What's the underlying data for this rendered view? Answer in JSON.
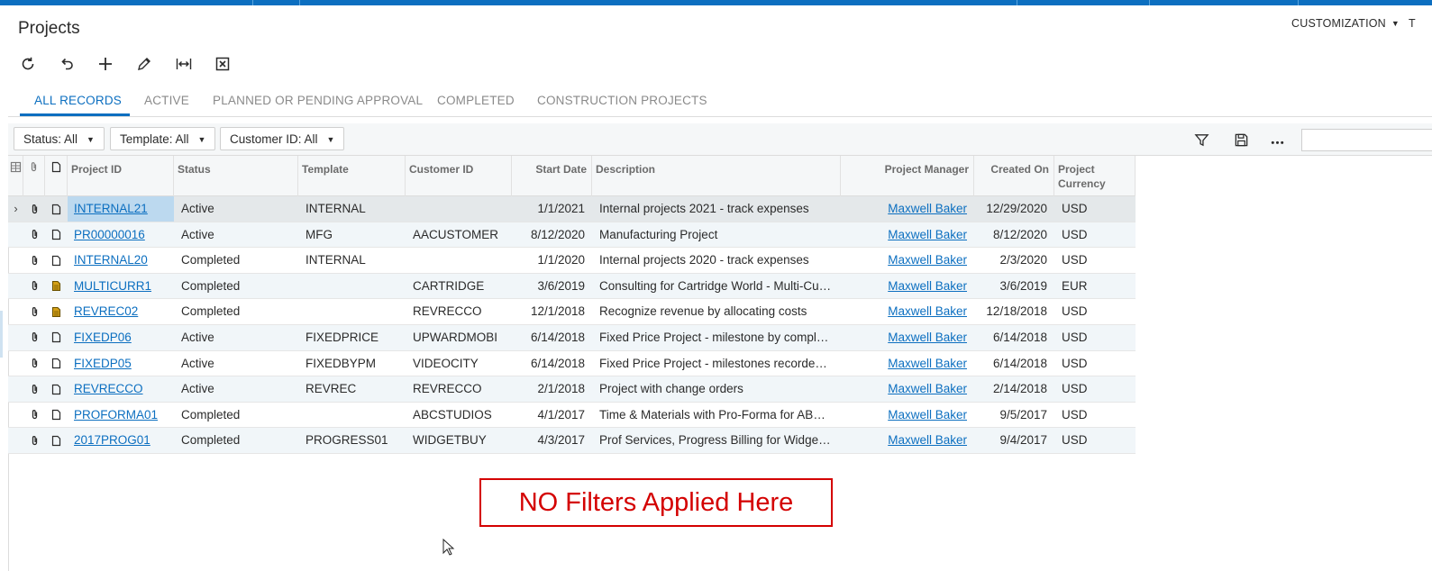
{
  "app": {
    "page_title": "Projects",
    "customization_label": "CUSTOMIZATION",
    "truncated_edge_label": "T"
  },
  "toolbar": {
    "buttons": [
      {
        "icon": "refresh-icon"
      },
      {
        "icon": "undo-icon"
      },
      {
        "icon": "add-icon"
      },
      {
        "icon": "edit-icon"
      },
      {
        "icon": "fit-width-icon"
      },
      {
        "icon": "excel-export-icon"
      }
    ]
  },
  "tabs": [
    {
      "label": "ALL RECORDS",
      "active": true
    },
    {
      "label": "ACTIVE",
      "active": false
    },
    {
      "label": "PLANNED OR PENDING APPROVAL",
      "active": false
    },
    {
      "label": "COMPLETED",
      "active": false
    },
    {
      "label": "CONSTRUCTION PROJECTS",
      "active": false
    }
  ],
  "filters": {
    "status": "Status: All",
    "template": "Template: All",
    "customer": "Customer ID: All",
    "search_value": ""
  },
  "grid": {
    "headers": {
      "project_id": "Project ID",
      "status": "Status",
      "template": "Template",
      "customer_id": "Customer ID",
      "start_date": "Start Date",
      "description": "Description",
      "project_manager": "Project Manager",
      "created_on": "Created On",
      "project_currency_line1": "Project",
      "project_currency_line2": "Currency"
    },
    "rows": [
      {
        "project_id": "INTERNAL21",
        "status": "Active",
        "template": "INTERNAL",
        "customer_id": "",
        "start_date": "1/1/2021",
        "description": "Internal projects 2021 - track expenses",
        "project_manager": "Maxwell Baker",
        "created_on": "12/29/2020",
        "currency": "USD",
        "has_note": false
      },
      {
        "project_id": "PR00000016",
        "status": "Active",
        "template": "MFG",
        "customer_id": "AACUSTOMER",
        "start_date": "8/12/2020",
        "description": "Manufacturing Project",
        "project_manager": "Maxwell Baker",
        "created_on": "8/12/2020",
        "currency": "USD",
        "has_note": false
      },
      {
        "project_id": "INTERNAL20",
        "status": "Completed",
        "template": "INTERNAL",
        "customer_id": "",
        "start_date": "1/1/2020",
        "description": "Internal projects 2020 - track expenses",
        "project_manager": "Maxwell Baker",
        "created_on": "2/3/2020",
        "currency": "USD",
        "has_note": false
      },
      {
        "project_id": "MULTICURR1",
        "status": "Completed",
        "template": "",
        "customer_id": "CARTRIDGE",
        "start_date": "3/6/2019",
        "description": "Consulting for Cartridge World - Multi-Curre…",
        "project_manager": "Maxwell Baker",
        "created_on": "3/6/2019",
        "currency": "EUR",
        "has_note": true
      },
      {
        "project_id": "REVREC02",
        "status": "Completed",
        "template": "",
        "customer_id": "REVRECCO",
        "start_date": "12/1/2018",
        "description": "Recognize revenue by allocating costs",
        "project_manager": "Maxwell Baker",
        "created_on": "12/18/2018",
        "currency": "USD",
        "has_note": true
      },
      {
        "project_id": "FIXEDP06",
        "status": "Active",
        "template": "FIXEDPRICE",
        "customer_id": "UPWARDMOBI",
        "start_date": "6/14/2018",
        "description": "Fixed Price Project - milestone by complet…",
        "project_manager": "Maxwell Baker",
        "created_on": "6/14/2018",
        "currency": "USD",
        "has_note": false
      },
      {
        "project_id": "FIXEDP05",
        "status": "Active",
        "template": "FIXEDBYPM",
        "customer_id": "VIDEOCITY",
        "start_date": "6/14/2018",
        "description": "Fixed Price Project - milestones recorded …",
        "project_manager": "Maxwell Baker",
        "created_on": "6/14/2018",
        "currency": "USD",
        "has_note": false
      },
      {
        "project_id": "REVRECCO",
        "status": "Active",
        "template": "REVREC",
        "customer_id": "REVRECCO",
        "start_date": "2/1/2018",
        "description": "Project with change orders",
        "project_manager": "Maxwell Baker",
        "created_on": "2/14/2018",
        "currency": "USD",
        "has_note": false
      },
      {
        "project_id": "PROFORMA01",
        "status": "Completed",
        "template": "",
        "customer_id": "ABCSTUDIOS",
        "start_date": "4/1/2017",
        "description": "Time & Materials with Pro-Forma for ABC …",
        "project_manager": "Maxwell Baker",
        "created_on": "9/5/2017",
        "currency": "USD",
        "has_note": false
      },
      {
        "project_id": "2017PROG01",
        "status": "Completed",
        "template": "PROGRESS01",
        "customer_id": "WIDGETBUY",
        "start_date": "4/3/2017",
        "description": "Prof Services, Progress Billing for Widget …",
        "project_manager": "Maxwell Baker",
        "created_on": "9/4/2017",
        "currency": "USD",
        "has_note": false
      }
    ]
  },
  "annotation": {
    "text": "NO Filters Applied Here",
    "color": "#d40000"
  },
  "colors": {
    "accent": "#0c6fc0",
    "note_icon": "#d4a017"
  }
}
